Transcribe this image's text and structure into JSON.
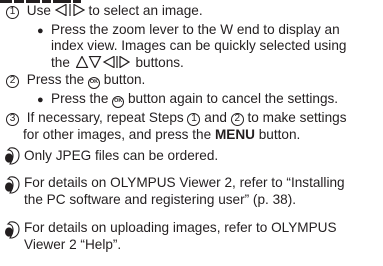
{
  "steps": [
    {
      "number": "1",
      "text_a": "Use",
      "icon": "left-right-arrows-icon",
      "text_b": "to select an image.",
      "sub_bullet": {
        "lines": [
          "Press the zoom lever to the W end to display an",
          "index view. Images can be quickly selected using"
        ],
        "line3_prefix": "the",
        "line3_icon": "up-down-left-right-arrows-icon",
        "line3_suffix": "buttons."
      }
    },
    {
      "number": "2",
      "text_a": "Press the",
      "icon_label": "OK",
      "text_b": "button.",
      "sub_bullet": {
        "prefix": "Press the",
        "icon_label": "OK",
        "suffix": "button again to cancel the settings."
      }
    },
    {
      "number": "3",
      "line1_a": "If necessary, repeat Steps",
      "ref1": "1",
      "line1_b": "and",
      "ref2": "2",
      "line1_c": "to make settings",
      "line2_a": "for other images, and press the",
      "line2_bold": "MENU",
      "line2_b": "button."
    }
  ],
  "notes": [
    {
      "icon": "note-icon",
      "lines": [
        "Only JPEG files can be ordered."
      ]
    },
    {
      "icon": "note-icon",
      "lines": [
        "For details on OLYMPUS Viewer 2, refer to “Installing",
        "the PC software and registering user” (p. 38)."
      ]
    },
    {
      "icon": "note-icon",
      "lines": [
        "For details on uploading images, refer to OLYMPUS",
        "Viewer 2 “Help”."
      ]
    }
  ]
}
